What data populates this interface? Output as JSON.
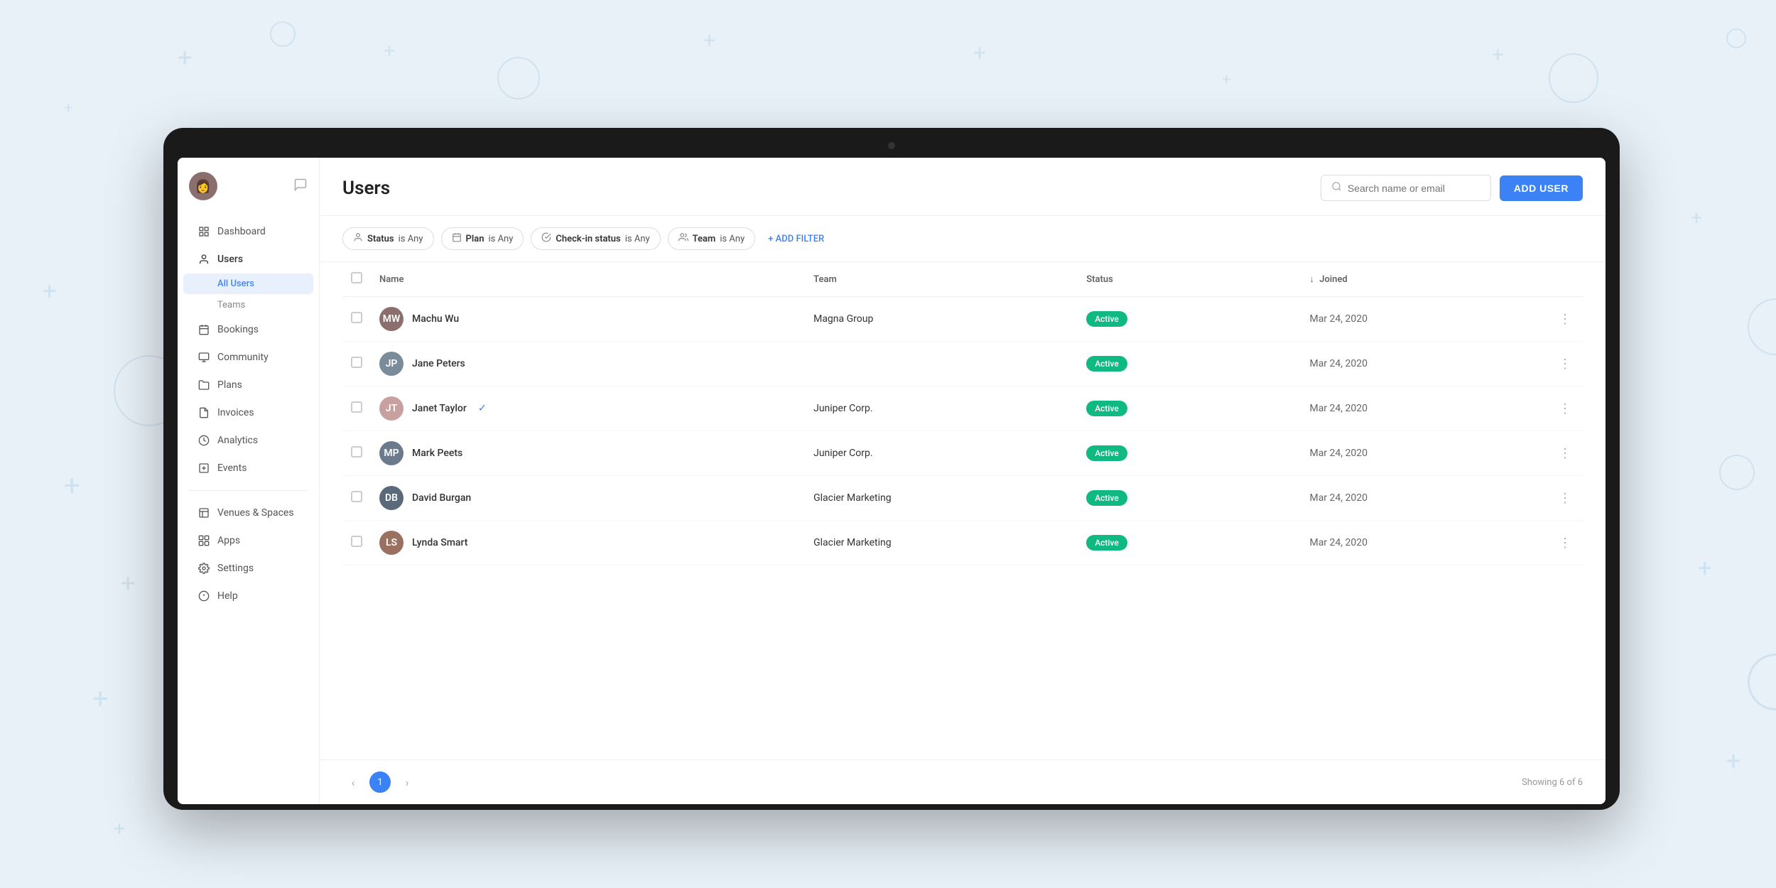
{
  "background": {
    "color": "#e8f1f8"
  },
  "sidebar": {
    "nav_items": [
      {
        "id": "dashboard",
        "label": "Dashboard",
        "icon": "grid-icon"
      },
      {
        "id": "users",
        "label": "Users",
        "icon": "user-icon",
        "has_children": true
      },
      {
        "id": "bookings",
        "label": "Bookings",
        "icon": "calendar-icon"
      },
      {
        "id": "community",
        "label": "Community",
        "icon": "monitor-icon"
      },
      {
        "id": "plans",
        "label": "Plans",
        "icon": "folder-icon"
      },
      {
        "id": "invoices",
        "label": "Invoices",
        "icon": "doc-icon"
      },
      {
        "id": "analytics",
        "label": "Analytics",
        "icon": "clock-icon"
      },
      {
        "id": "events",
        "label": "Events",
        "icon": "plus-square-icon"
      }
    ],
    "sub_items": [
      {
        "id": "all-users",
        "label": "All Users",
        "active": true
      },
      {
        "id": "teams",
        "label": "Teams",
        "active": false
      }
    ],
    "bottom_items": [
      {
        "id": "venues-spaces",
        "label": "Venues & Spaces",
        "icon": "layout-icon"
      },
      {
        "id": "apps",
        "label": "Apps",
        "icon": "apps-icon"
      },
      {
        "id": "settings",
        "label": "Settings",
        "icon": "gear-icon"
      },
      {
        "id": "help",
        "label": "Help",
        "icon": "info-icon"
      }
    ]
  },
  "page": {
    "title": "Users",
    "search_placeholder": "Search name or email",
    "add_user_label": "ADD USER"
  },
  "filters": [
    {
      "id": "status-filter",
      "key": "Status",
      "value": "is Any",
      "icon": "person-icon"
    },
    {
      "id": "plan-filter",
      "key": "Plan",
      "value": "is Any",
      "icon": "calendar-icon"
    },
    {
      "id": "checkin-filter",
      "key": "Check-in status",
      "value": "is Any",
      "icon": "check-icon"
    },
    {
      "id": "team-filter",
      "key": "Team",
      "value": "is Any",
      "icon": "team-icon"
    }
  ],
  "add_filter_label": "+ ADD FILTER",
  "table": {
    "columns": [
      {
        "id": "checkbox",
        "label": ""
      },
      {
        "id": "name",
        "label": "Name"
      },
      {
        "id": "team",
        "label": "Team"
      },
      {
        "id": "status",
        "label": "Status"
      },
      {
        "id": "joined",
        "label": "Joined",
        "sortable": true
      }
    ],
    "rows": [
      {
        "id": 1,
        "name": "Machu Wu",
        "team": "Magna Group",
        "status": "Active",
        "joined": "Mar 24, 2020",
        "verified": false,
        "avatar_color": "av-brown",
        "initials": "MW"
      },
      {
        "id": 2,
        "name": "Jane Peters",
        "team": "",
        "status": "Active",
        "joined": "Mar 24, 2020",
        "verified": false,
        "avatar_color": "av-gray",
        "initials": "JP"
      },
      {
        "id": 3,
        "name": "Janet Taylor",
        "team": "Juniper Corp.",
        "status": "Active",
        "joined": "Mar 24, 2020",
        "verified": true,
        "avatar_color": "av-pink",
        "initials": "JT"
      },
      {
        "id": 4,
        "name": "Mark Peets",
        "team": "Juniper Corp.",
        "status": "Active",
        "joined": "Mar 24, 2020",
        "verified": false,
        "avatar_color": "av-slate",
        "initials": "MP"
      },
      {
        "id": 5,
        "name": "David Burgan",
        "team": "Glacier Marketing",
        "status": "Active",
        "joined": "Mar 24, 2020",
        "verified": false,
        "avatar_color": "av-dark",
        "initials": "DB"
      },
      {
        "id": 6,
        "name": "Lynda Smart",
        "team": "Glacier Marketing",
        "status": "Active",
        "joined": "Mar 24, 2020",
        "verified": false,
        "avatar_color": "av-auburn",
        "initials": "LS"
      }
    ]
  },
  "pagination": {
    "current_page": 1,
    "total_pages": 1,
    "showing_text": "Showing 6 of 6"
  }
}
